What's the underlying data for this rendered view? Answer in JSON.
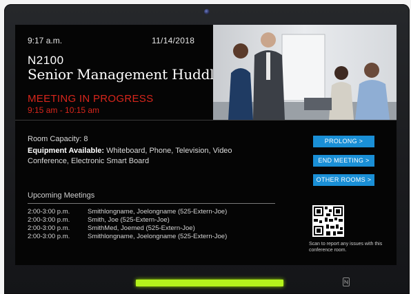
{
  "header": {
    "time": "9:17 a.m.",
    "date": "11/14/2018",
    "room_id": "N2100",
    "meeting_title": "Senior Management Huddle",
    "status": "MEETING IN PROGRESS",
    "status_time": "9:15 am - 10:15 am"
  },
  "details": {
    "capacity_label": "Room Capacity:",
    "capacity_value": "8",
    "equipment_label": "Equipment Available:",
    "equipment_value": "Whiteboard, Phone, Television, Video Conference, Electronic Smart Board"
  },
  "buttons": {
    "prolong": "PROLONG >",
    "end_meeting": "END MEETING >",
    "other_rooms": "OTHER ROOMS >"
  },
  "upcoming": {
    "heading": "Upcoming Meetings",
    "rows": [
      {
        "time": "2:00-3:00 p.m.",
        "organizer": "Smithlongname, Joelongname (525-Extern-Joe)"
      },
      {
        "time": "2:00-3:00 p.m.",
        "organizer": "Smith, Joe (525-Extern-Joe)"
      },
      {
        "time": "2:00-3:00 p.m.",
        "organizer": "SmithMed, Joemed (525-Extern-Joe)"
      },
      {
        "time": "2:00-3:00 p.m.",
        "organizer": "Smithlongname, Joelongname (525-Extern-Joe)"
      }
    ]
  },
  "qr": {
    "caption": "Scan to report any issues with this conference room."
  },
  "colors": {
    "status_red": "#d8261c",
    "button_blue": "#1a8fd6",
    "led_green": "#b5f41c"
  },
  "icons": {
    "nfc": "nfc-icon",
    "camera": "camera-icon"
  }
}
